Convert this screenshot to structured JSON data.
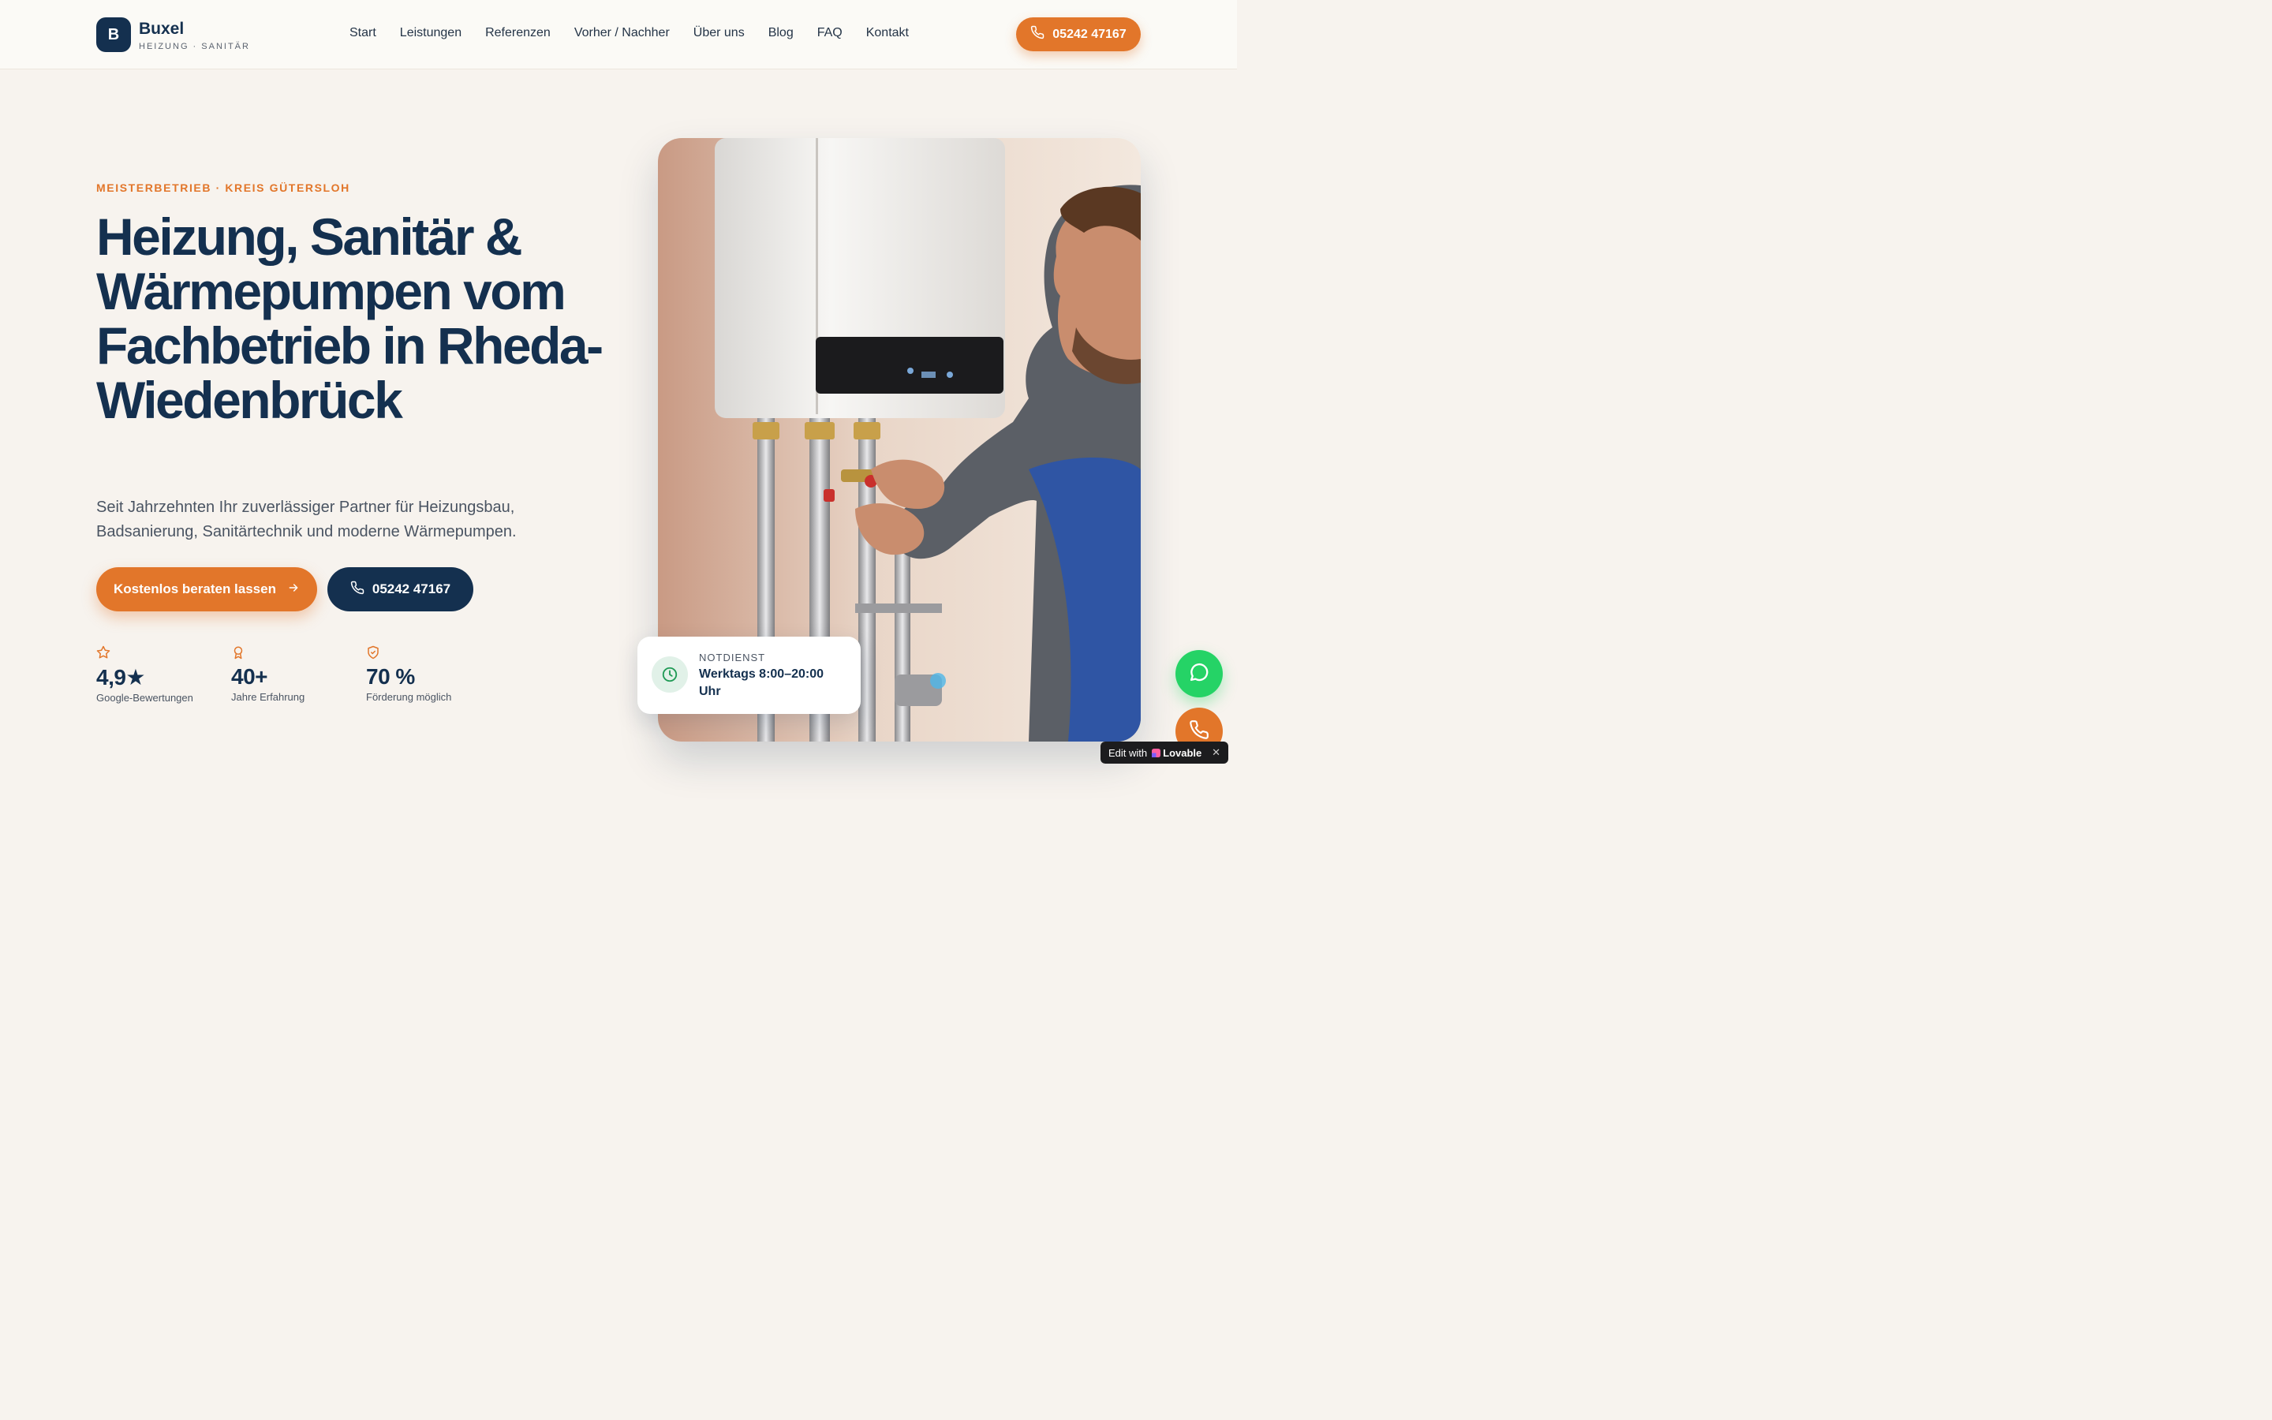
{
  "header": {
    "logo_letter": "B",
    "brand_name": "Buxel",
    "brand_sub": "HEIZUNG · SANITÄR",
    "nav": [
      "Start",
      "Leistungen",
      "Referenzen",
      "Vorher / Nachher",
      "Über uns",
      "Blog",
      "FAQ",
      "Kontakt"
    ],
    "phone": "05242 47167"
  },
  "hero": {
    "eyebrow": "MEISTERBETRIEB · KREIS GÜTERSLOH",
    "headline": "Heizung, Sanitär & Wärmepumpen vom Fachbetrieb in Rheda-Wiedenbrück",
    "subtext": "Seit Jahrzehnten Ihr zuverlässiger Partner für Heizungsbau, Badsanierung, Sanitärtechnik und moderne Wärmepumpen.",
    "cta_primary": "Kostenlos beraten lassen",
    "cta_phone": "05242 47167",
    "stats": [
      {
        "icon": "star-icon",
        "value": "4,9★",
        "label": "Google-Bewertungen"
      },
      {
        "icon": "award-icon",
        "value": "40+",
        "label": "Jahre Erfahrung"
      },
      {
        "icon": "shield-check-icon",
        "value": "70 %",
        "label": "Förderung möglich"
      }
    ],
    "image_alt_icon": "technician-photo",
    "notdienst": {
      "label": "NOTDIENST",
      "text": "Werktags 8:00–20:00 Uhr"
    }
  },
  "floating": {
    "whatsapp_icon": "whatsapp-icon",
    "call_icon": "phone-icon"
  },
  "badge": {
    "prefix": "Edit with",
    "brand": "Lovable",
    "close": "✕"
  },
  "colors": {
    "primary": "#14304f",
    "accent": "#e2762a",
    "background": "#f7f3ee",
    "whatsapp": "#25d366"
  }
}
